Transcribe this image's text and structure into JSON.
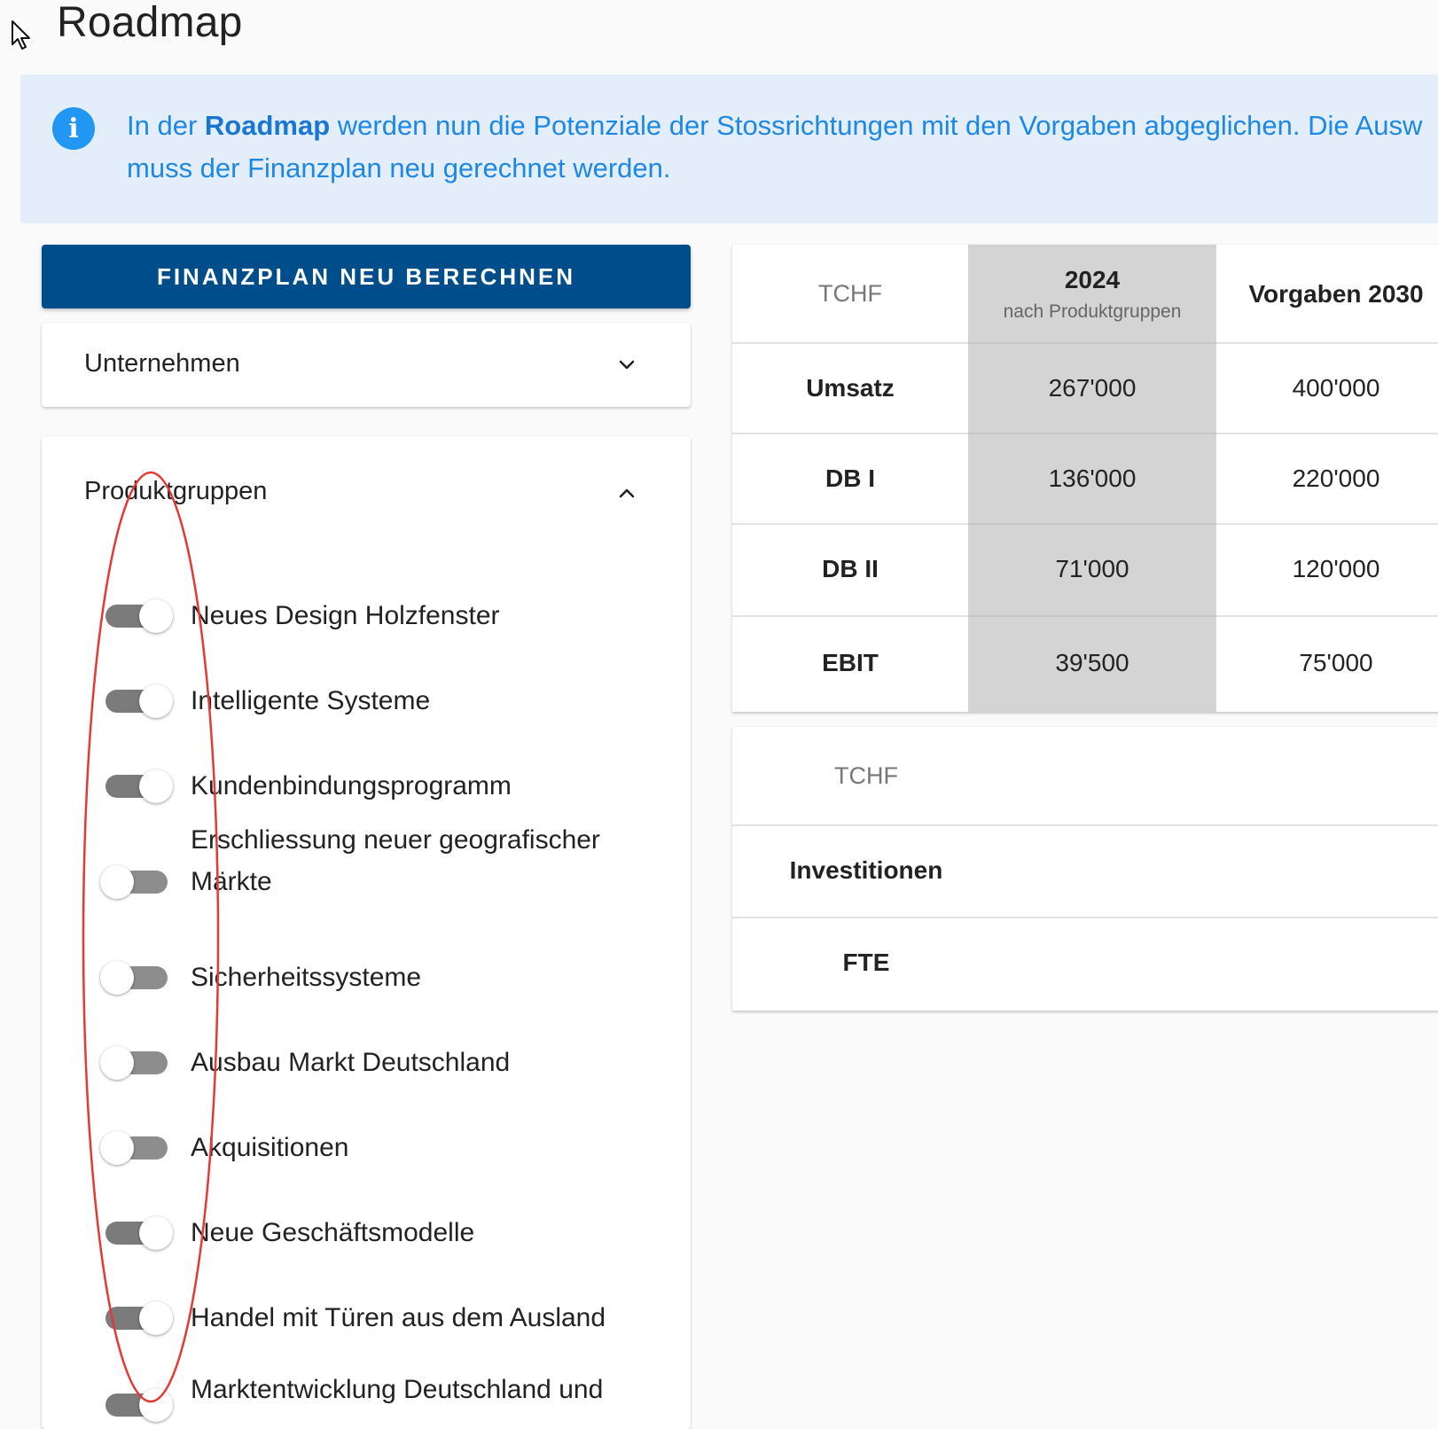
{
  "page": {
    "title": "Roadmap"
  },
  "info_banner": {
    "text_before": "In der ",
    "text_bold": "Roadmap",
    "text_after": " werden nun die Potenziale der Stossrichtungen mit den Vorgaben abgeglichen. Die Ausw",
    "text_line2": "muss der Finanzplan neu gerechnet werden."
  },
  "recalc_button": {
    "label": "FINANZPLAN NEU BERECHNEN"
  },
  "unternehmen_panel": {
    "label": "Unternehmen",
    "expanded": false
  },
  "produktgruppen_panel": {
    "label": "Produktgruppen",
    "expanded": true,
    "items": [
      {
        "label": "Neues Design Holzfenster",
        "enabled": true
      },
      {
        "label": "Intelligente Systeme",
        "enabled": true
      },
      {
        "label": "Kundenbindungsprogramm",
        "enabled": true
      },
      {
        "label": "Erschliessung neuer geografischer Märkte",
        "enabled": false
      },
      {
        "label": "Sicherheitssysteme",
        "enabled": false
      },
      {
        "label": "Ausbau Markt Deutschland",
        "enabled": false
      },
      {
        "label": "Akquisitionen",
        "enabled": false
      },
      {
        "label": "Neue Geschäftsmodelle",
        "enabled": true
      },
      {
        "label": "Handel mit Türen aus dem Ausland",
        "enabled": true
      },
      {
        "label": "Marktentwicklung Deutschland und",
        "enabled": true
      }
    ]
  },
  "finance_table": {
    "header": {
      "unit": "TCHF",
      "col_2024": "2024",
      "col_2024_sub": "nach Produktgruppen",
      "col_2030": "Vorgaben 2030"
    },
    "rows": [
      {
        "label": "Umsatz",
        "v2024": "267'000",
        "v2030": "400'000"
      },
      {
        "label": "DB I",
        "v2024": "136'000",
        "v2030": "220'000"
      },
      {
        "label": "DB II",
        "v2024": "71'000",
        "v2030": "120'000"
      },
      {
        "label": "EBIT",
        "v2024": "39'500",
        "v2030": "75'000"
      }
    ]
  },
  "resources_table": {
    "header": {
      "unit": "TCHF"
    },
    "rows": [
      {
        "label": "Investitionen"
      },
      {
        "label": "FTE"
      }
    ]
  },
  "colors": {
    "primary_button": "#004d8c",
    "info_bg": "#e3eefa",
    "info_text": "#1e88e5",
    "highlight_column": "#d4d4d4",
    "annotation": "#e53935"
  }
}
